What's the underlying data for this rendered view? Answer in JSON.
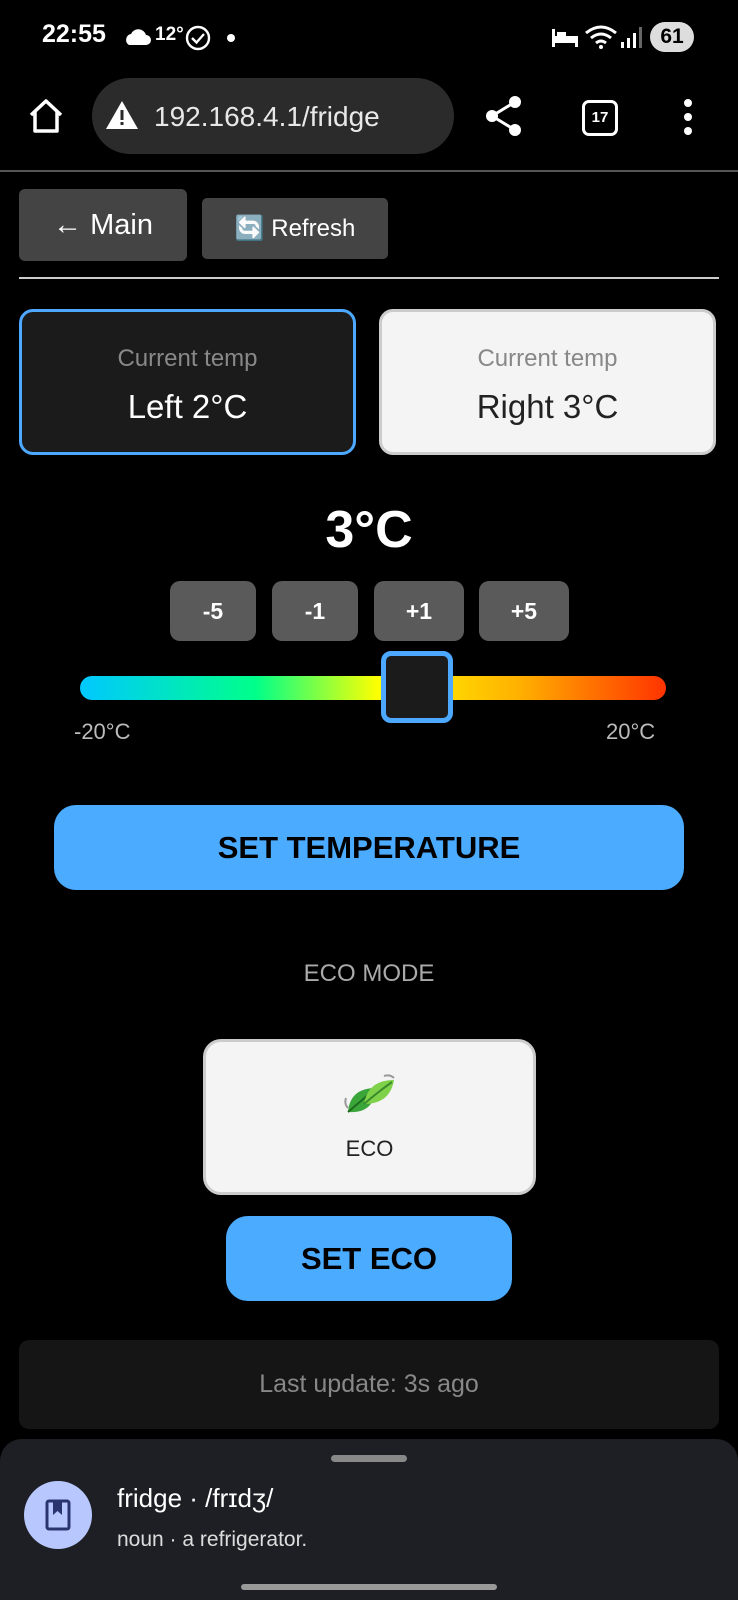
{
  "status_bar": {
    "time": "22:55",
    "weather_temp": "12°",
    "battery": "61"
  },
  "browser": {
    "url": "192.168.4.1/fridge",
    "tab_count": "17"
  },
  "nav": {
    "main_label": "← Main",
    "refresh_label": "🔄 Refresh"
  },
  "zones": {
    "left": {
      "caption": "Current temp",
      "value": "Left 2°C",
      "selected": true
    },
    "right": {
      "caption": "Current temp",
      "value": "Right 3°C",
      "selected": false
    }
  },
  "setpoint": {
    "display": "3°C",
    "value": 3,
    "min": -20,
    "max": 20,
    "min_label": "-20°C",
    "max_label": "20°C",
    "steps": [
      "-5",
      "-1",
      "+1",
      "+5"
    ]
  },
  "actions": {
    "set_temperature": "SET TEMPERATURE",
    "set_eco": "SET ECO"
  },
  "eco": {
    "heading": "ECO MODE",
    "icon": "🍃",
    "label": "ECO"
  },
  "status": {
    "last_update": "Last update: 3s ago"
  },
  "dictionary": {
    "word_line": "fridge · /frɪdʒ/",
    "definition": "noun · a refrigerator."
  },
  "colors": {
    "accent": "#4aabff",
    "background": "#000000",
    "button_gray": "#444444"
  }
}
